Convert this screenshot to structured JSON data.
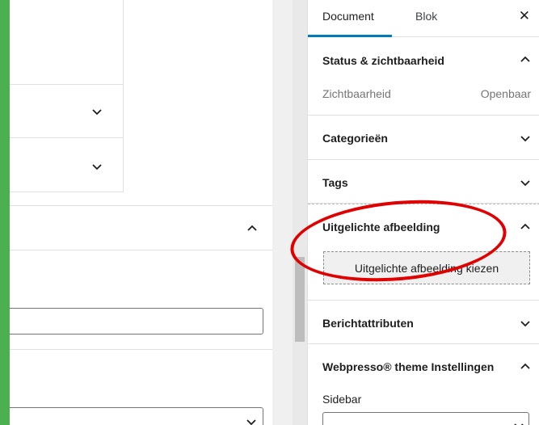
{
  "sidebar": {
    "tabs": [
      {
        "label": "Document",
        "active": true
      },
      {
        "label": "Blok",
        "active": false
      }
    ],
    "close_icon": "close-icon",
    "sections": {
      "status": {
        "title": "Status & zichtbaarheid",
        "expanded": true,
        "visibility_label": "Zichtbaarheid",
        "visibility_value": "Openbaar"
      },
      "categories": {
        "title": "Categorieën",
        "expanded": false
      },
      "tags": {
        "title": "Tags",
        "expanded": false
      },
      "featured_image": {
        "title": "Uitgelichte afbeelding",
        "expanded": true,
        "button_label": "Uitgelichte afbeelding kiezen"
      },
      "post_attributes": {
        "title": "Berichtattributen",
        "expanded": false
      },
      "theme_settings": {
        "title": "Webpresso® theme Instellingen",
        "expanded": true,
        "field_label": "Sidebar"
      }
    }
  },
  "colors": {
    "accent": "#007cba",
    "annotation": "#e10000",
    "frame": "#4caf50"
  }
}
